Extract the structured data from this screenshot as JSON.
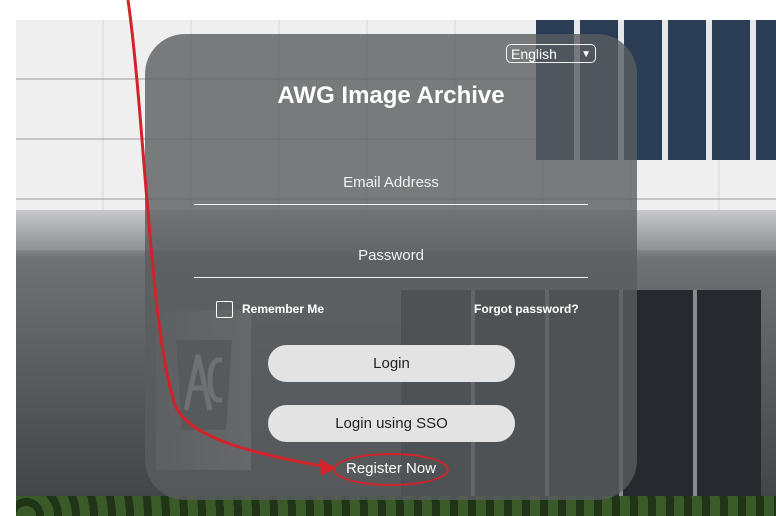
{
  "app": {
    "title": "AWG Image Archive",
    "language": "English"
  },
  "form": {
    "email_placeholder": "Email Address",
    "password_placeholder": "Password",
    "remember_label": "Remember Me",
    "forgot_label": "Forgot password?",
    "login_label": "Login",
    "sso_label": "Login using SSO",
    "register_label": "Register Now"
  },
  "icons": {
    "language_dropdown": "chevron-down-icon",
    "annotation": "red-arrow-annotation"
  },
  "colors": {
    "annotation": "#d4222a",
    "panel": "#5a5c5f",
    "button": "#e3e3e4"
  }
}
